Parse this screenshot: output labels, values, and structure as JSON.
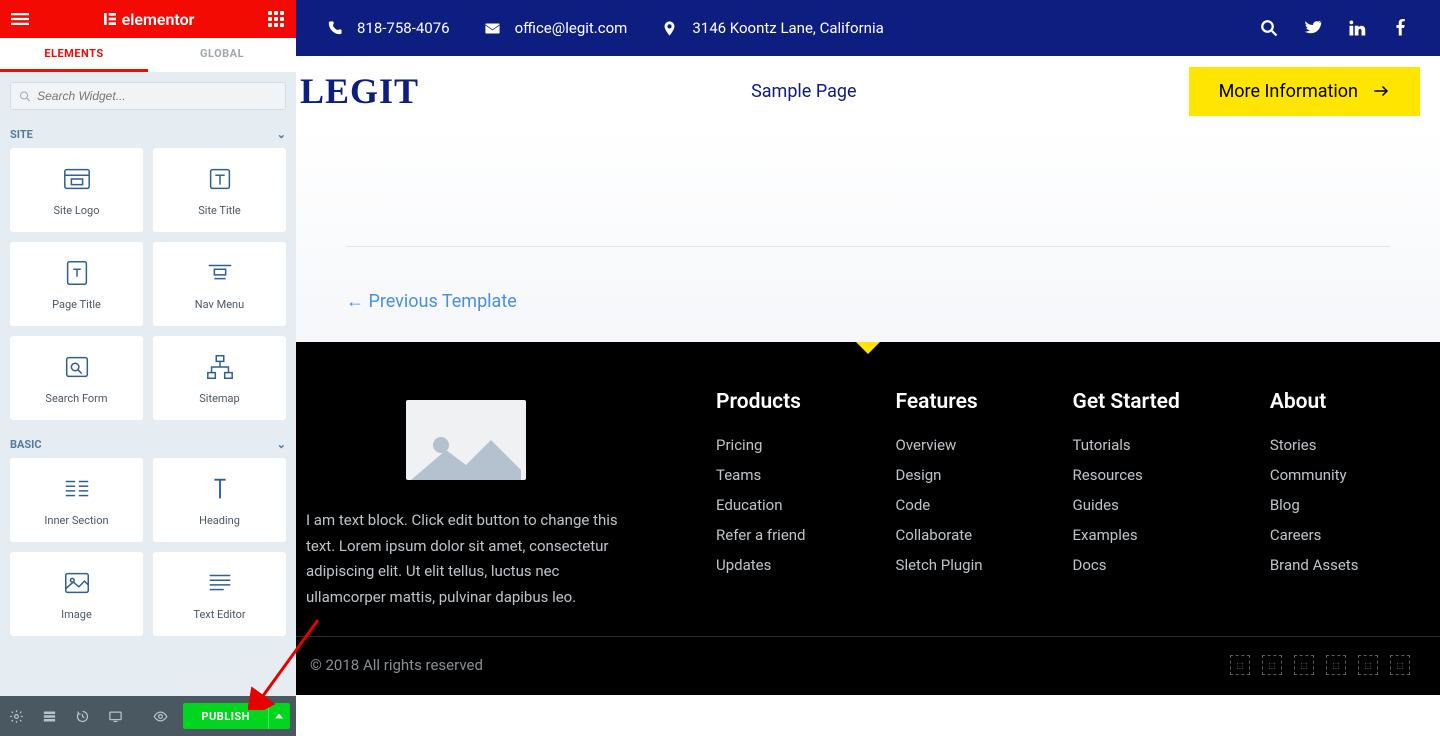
{
  "brand": "elementor",
  "panel_tabs": {
    "elements": "ELEMENTS",
    "global": "GLOBAL"
  },
  "search_placeholder": "Search Widget...",
  "categories": {
    "site": "SITE",
    "basic": "BASIC"
  },
  "widgets": {
    "site": [
      {
        "label": "Site Logo",
        "icon": "logo"
      },
      {
        "label": "Site Title",
        "icon": "title"
      },
      {
        "label": "Page Title",
        "icon": "page-title"
      },
      {
        "label": "Nav Menu",
        "icon": "nav"
      },
      {
        "label": "Search Form",
        "icon": "search"
      },
      {
        "label": "Sitemap",
        "icon": "sitemap"
      }
    ],
    "basic": [
      {
        "label": "Inner Section",
        "icon": "columns"
      },
      {
        "label": "Heading",
        "icon": "heading"
      },
      {
        "label": "Image",
        "icon": "image"
      },
      {
        "label": "Text Editor",
        "icon": "text"
      }
    ]
  },
  "publish_label": "PUBLISH",
  "preview": {
    "topbar": {
      "phone": "818-758-4076",
      "email": "office@legit.com",
      "address": "3146 Koontz Lane, California"
    },
    "site_title": "LEGIT",
    "nav": "Sample Page",
    "more_btn": "More Information",
    "prev_link": "← Previous Template",
    "footer_text": "I am text block. Click edit button to change this text. Lorem ipsum dolor sit amet, consectetur adipiscing elit. Ut elit tellus, luctus nec ullamcorper mattis, pulvinar dapibus leo.",
    "footer_cols": [
      {
        "title": "Products",
        "items": [
          "Pricing",
          "Teams",
          "Education",
          "Refer a friend",
          "Updates"
        ]
      },
      {
        "title": "Features",
        "items": [
          "Overview",
          "Design",
          "Code",
          "Collaborate",
          "Sletch Plugin"
        ]
      },
      {
        "title": "Get Started",
        "items": [
          "Tutorials",
          "Resources",
          "Guides",
          "Examples",
          "Docs"
        ]
      },
      {
        "title": "About",
        "items": [
          "Stories",
          "Community",
          "Blog",
          "Careers",
          "Brand Assets"
        ]
      }
    ],
    "copyright": "© 2018 All rights reserved"
  }
}
